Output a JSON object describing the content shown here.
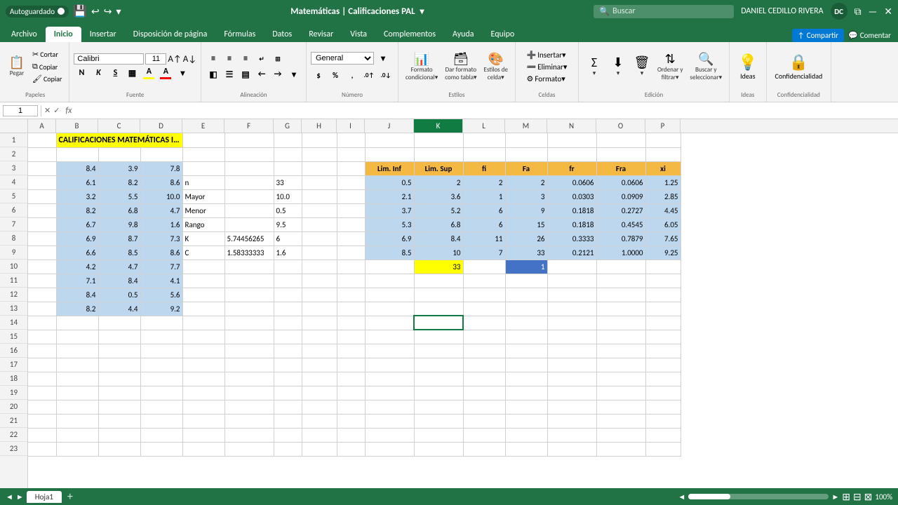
{
  "titlebar": {
    "autosave": "Autoguardado",
    "title": "Matemáticas | Calificaciones PAL",
    "user": "DANIEL CEDILLO RIVERA",
    "user_initials": "DC",
    "undo_label": "Deshacer",
    "redo_label": "Rehacer"
  },
  "ribbon": {
    "tabs": [
      "Archivo",
      "Inicio",
      "Insertar",
      "Disposición de página",
      "Fórmulas",
      "Datos",
      "Revisar",
      "Vista",
      "Complementos",
      "Ayuda",
      "Equipo"
    ],
    "active_tab": "Inicio",
    "share_label": "Compartir",
    "comment_label": "Comentar",
    "groups": {
      "fuente": {
        "label": "Fuente",
        "font_name": "Calibri",
        "font_size": "11",
        "bold": "N",
        "italic": "K",
        "underline": "S"
      },
      "alineacion": {
        "label": "Alineación"
      },
      "numero": {
        "label": "Número",
        "format": "General"
      },
      "estilos": {
        "label": "Estilos"
      },
      "celdas": {
        "label": "Celdas",
        "insertar": "Insertar",
        "eliminar": "Eliminar",
        "formato": "Formato"
      },
      "edicion": {
        "label": "Edición",
        "ordenar": "Ordenar y filtrar",
        "buscar": "Buscar y seleccionar"
      },
      "ideas": {
        "label": "Ideas",
        "btn": "Ideas"
      },
      "confidencialidad": {
        "label": "Confidencialidad",
        "btn": "Confidencialidad"
      }
    }
  },
  "formula_bar": {
    "cell_ref": "1",
    "formula": ""
  },
  "columns": {
    "widths": [
      40,
      60,
      60,
      60,
      60,
      60,
      60,
      60,
      60,
      60,
      80,
      80,
      80,
      80,
      80,
      80,
      80
    ],
    "labels": [
      "",
      "A",
      "B",
      "C",
      "D",
      "E",
      "F",
      "G",
      "H",
      "I",
      "J",
      "K",
      "L",
      "M",
      "N",
      "O",
      "P"
    ]
  },
  "sheet": {
    "active_cell": "K14",
    "tab_name": "Hoja1",
    "rows": [
      {
        "id": 1,
        "cells": {
          "B": "CALIFICACIONES MATEMÁTICAS I PAL",
          "style_B": "title-cell",
          "colspan_B": 3
        }
      },
      {
        "id": 2,
        "cells": {}
      },
      {
        "id": 3,
        "cells": {
          "B": "8.4",
          "C": "3.9",
          "D": "7.8",
          "J": "Lim. Inf",
          "K": "Lim. Sup",
          "L": "fi",
          "M": "Fa",
          "N": "fr",
          "O": "Fra",
          "P": "xi",
          "style_B": "num-cell data-blue",
          "style_C": "num-cell data-blue",
          "style_D": "num-cell data-blue",
          "style_J": "orange-header",
          "style_K": "orange-header",
          "style_L": "orange-header",
          "style_M": "orange-header",
          "style_N": "orange-header",
          "style_O": "orange-header",
          "style_P": "orange-header"
        }
      },
      {
        "id": 4,
        "cells": {
          "B": "6.1",
          "C": "8.2",
          "D": "8.6",
          "E": "n",
          "G": "33",
          "J": "0.5",
          "K": "2",
          "L": "2",
          "M": "2",
          "N": "0.0606",
          "O": "0.0606",
          "P": "1.25",
          "style_B": "num-cell data-blue",
          "style_C": "num-cell data-blue",
          "style_D": "num-cell data-blue",
          "style_J": "num-cell data-blue",
          "style_K": "num-cell data-blue",
          "style_L": "num-cell data-blue",
          "style_M": "num-cell data-blue",
          "style_N": "num-cell data-blue",
          "style_O": "num-cell data-blue",
          "style_P": "num-cell data-blue"
        }
      },
      {
        "id": 5,
        "cells": {
          "B": "3.2",
          "C": "5.5",
          "D": "10.0",
          "E": "Mayor",
          "G": "10.0",
          "J": "2.1",
          "K": "3.6",
          "L": "1",
          "M": "3",
          "N": "0.0303",
          "O": "0.0909",
          "P": "2.85",
          "style_B": "num-cell data-blue",
          "style_C": "num-cell data-blue",
          "style_D": "num-cell data-blue",
          "style_J": "num-cell data-blue",
          "style_K": "num-cell data-blue",
          "style_L": "num-cell data-blue",
          "style_M": "num-cell data-blue",
          "style_N": "num-cell data-blue",
          "style_O": "num-cell data-blue",
          "style_P": "num-cell data-blue"
        }
      },
      {
        "id": 6,
        "cells": {
          "B": "8.2",
          "C": "6.8",
          "D": "4.7",
          "E": "Menor",
          "G": "0.5",
          "J": "3.7",
          "K": "5.2",
          "L": "6",
          "M": "9",
          "N": "0.1818",
          "O": "0.2727",
          "P": "4.45",
          "style_B": "num-cell data-blue",
          "style_C": "num-cell data-blue",
          "style_D": "num-cell data-blue",
          "style_J": "num-cell data-blue",
          "style_K": "num-cell data-blue",
          "style_L": "num-cell data-blue",
          "style_M": "num-cell data-blue",
          "style_N": "num-cell data-blue",
          "style_O": "num-cell data-blue",
          "style_P": "num-cell data-blue"
        }
      },
      {
        "id": 7,
        "cells": {
          "B": "6.7",
          "C": "9.8",
          "D": "1.6",
          "E": "Rango",
          "G": "9.5",
          "J": "5.3",
          "K": "6.8",
          "L": "6",
          "M": "15",
          "N": "0.1818",
          "O": "0.4545",
          "P": "6.05",
          "style_B": "num-cell data-blue",
          "style_C": "num-cell data-blue",
          "style_D": "num-cell data-blue",
          "style_J": "num-cell data-blue",
          "style_K": "num-cell data-blue",
          "style_L": "num-cell data-blue",
          "style_M": "num-cell data-blue",
          "style_N": "num-cell data-blue",
          "style_O": "num-cell data-blue",
          "style_P": "num-cell data-blue"
        }
      },
      {
        "id": 8,
        "cells": {
          "B": "6.9",
          "C": "8.7",
          "D": "7.3",
          "E": "K",
          "F": "5.74456265",
          "G": "6",
          "J": "6.9",
          "K": "8.4",
          "L": "11",
          "M": "26",
          "N": "0.3333",
          "O": "0.7879",
          "P": "7.65",
          "style_B": "num-cell data-blue",
          "style_C": "num-cell data-blue",
          "style_D": "num-cell data-blue",
          "style_J": "num-cell data-blue",
          "style_K": "num-cell data-blue",
          "style_L": "num-cell data-blue",
          "style_M": "num-cell data-blue",
          "style_N": "num-cell data-blue",
          "style_O": "num-cell data-blue",
          "style_P": "num-cell data-blue"
        }
      },
      {
        "id": 9,
        "cells": {
          "B": "6.6",
          "C": "8.5",
          "D": "8.6",
          "E": "C",
          "F": "1.58333333",
          "G": "1.6",
          "J": "8.5",
          "K": "10",
          "L": "7",
          "M": "33",
          "N": "0.2121",
          "O": "1.0000",
          "P": "9.25",
          "style_B": "num-cell data-blue",
          "style_C": "num-cell data-blue",
          "style_D": "num-cell data-blue",
          "style_J": "num-cell data-blue",
          "style_K": "num-cell data-blue",
          "style_L": "num-cell data-blue",
          "style_M": "num-cell data-blue",
          "style_N": "num-cell data-blue",
          "style_O": "num-cell data-blue",
          "style_P": "num-cell data-blue"
        }
      },
      {
        "id": 10,
        "cells": {
          "B": "4.2",
          "C": "4.7",
          "D": "7.7",
          "K": "33",
          "M": "1",
          "style_B": "num-cell data-blue",
          "style_C": "num-cell data-blue",
          "style_D": "num-cell data-blue",
          "style_K": "yellow-bg num-cell",
          "style_M": "blue-bg num-cell"
        }
      },
      {
        "id": 11,
        "cells": {
          "B": "7.1",
          "C": "8.4",
          "D": "4.1",
          "style_B": "num-cell data-blue",
          "style_C": "num-cell data-blue",
          "style_D": "num-cell data-blue"
        }
      },
      {
        "id": 12,
        "cells": {
          "B": "8.4",
          "C": "0.5",
          "D": "5.6",
          "style_B": "num-cell data-blue",
          "style_C": "num-cell data-blue",
          "style_D": "num-cell data-blue"
        }
      },
      {
        "id": 13,
        "cells": {
          "B": "8.2",
          "C": "4.4",
          "D": "9.2",
          "style_B": "num-cell data-blue",
          "style_C": "num-cell data-blue",
          "style_D": "num-cell data-blue"
        }
      },
      {
        "id": 14,
        "cells": {
          "K": "",
          "style_K": "selected-cell"
        }
      },
      {
        "id": 15,
        "cells": {}
      },
      {
        "id": 16,
        "cells": {}
      },
      {
        "id": 17,
        "cells": {}
      },
      {
        "id": 18,
        "cells": {}
      },
      {
        "id": 19,
        "cells": {}
      },
      {
        "id": 20,
        "cells": {}
      },
      {
        "id": 21,
        "cells": {}
      },
      {
        "id": 22,
        "cells": {}
      },
      {
        "id": 23,
        "cells": {}
      }
    ]
  },
  "status_bar": {
    "scroll_left": "◄",
    "scroll_right": "►",
    "zoom_label": "100%"
  }
}
